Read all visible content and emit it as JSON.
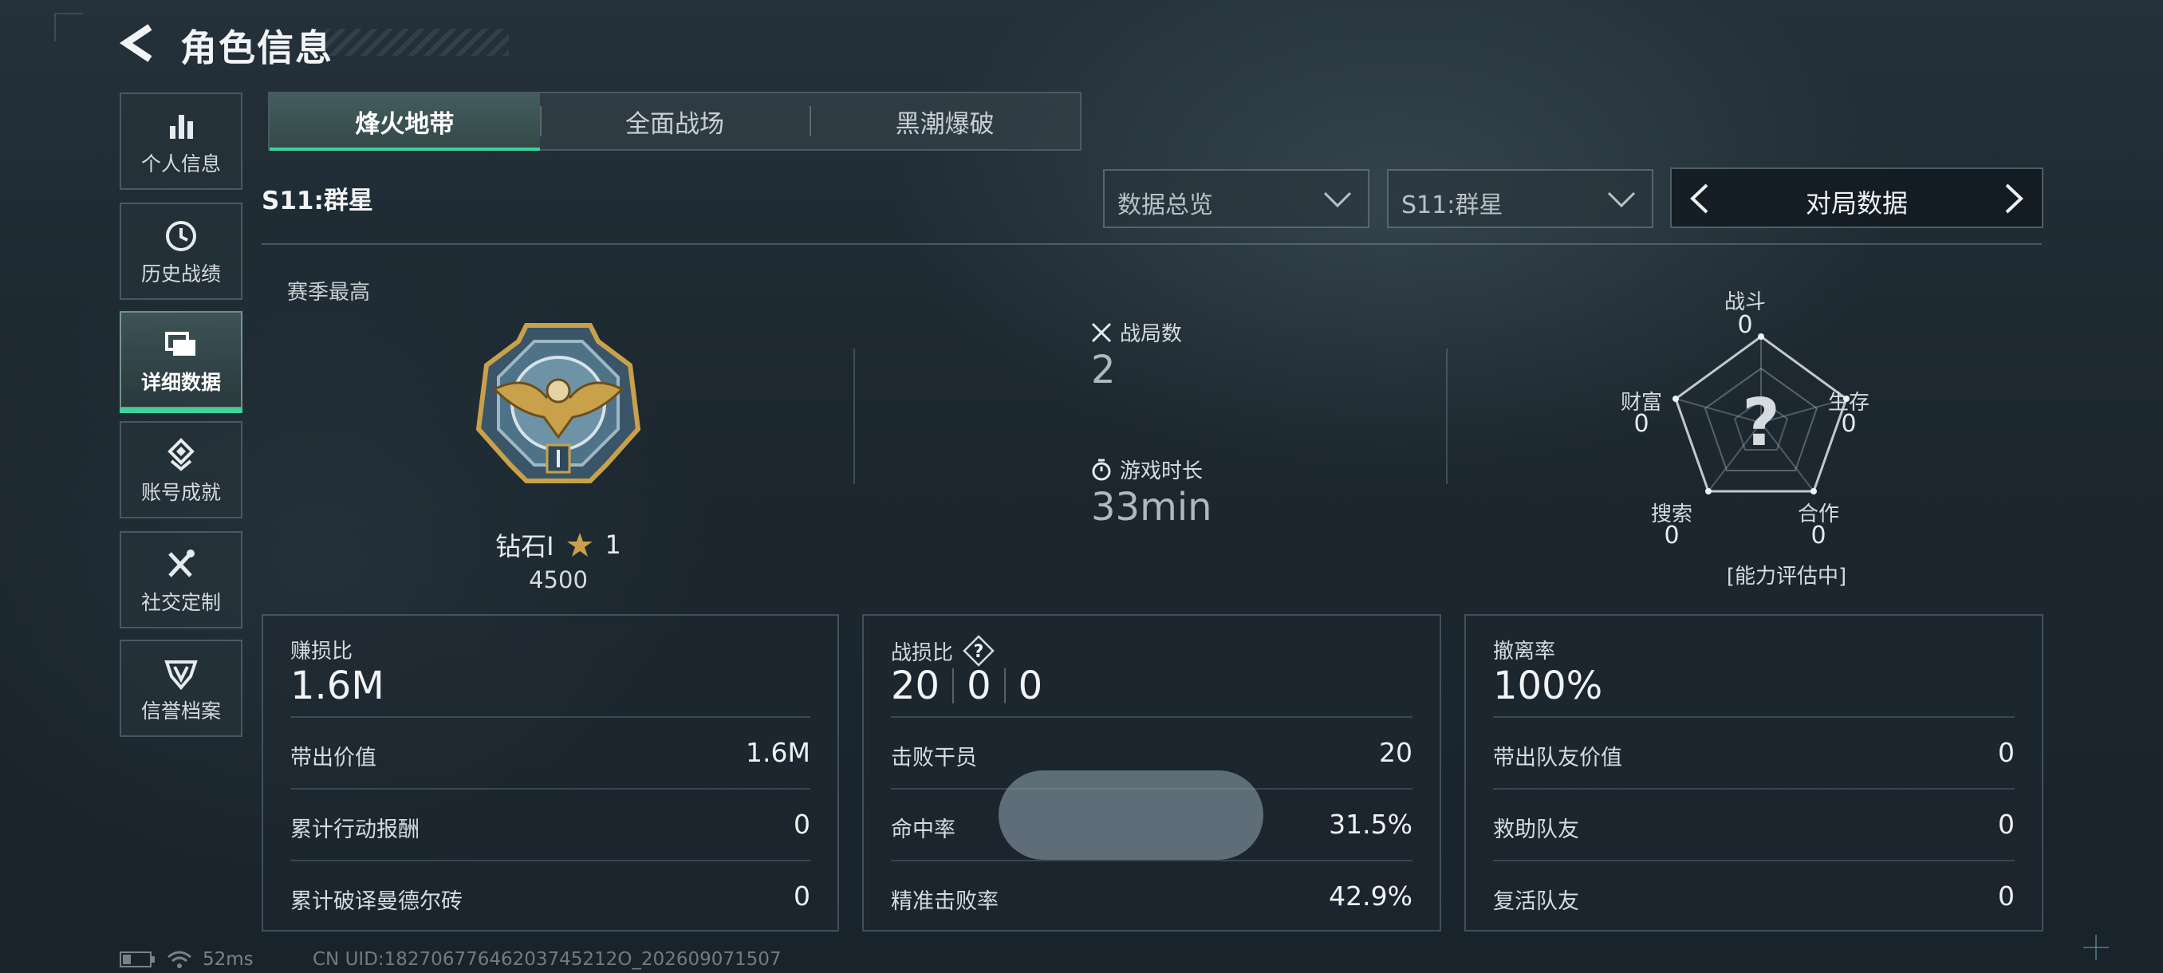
{
  "header": {
    "title": "角色信息"
  },
  "sidebar": {
    "items": [
      {
        "label": "个人信息",
        "icon": "bar-chart-icon"
      },
      {
        "label": "历史战绩",
        "icon": "clock-icon"
      },
      {
        "label": "详细数据",
        "icon": "folder-icon",
        "active": true
      },
      {
        "label": "账号成就",
        "icon": "achievement-icon"
      },
      {
        "label": "社交定制",
        "icon": "tools-icon"
      },
      {
        "label": "信誉档案",
        "icon": "shield-icon"
      }
    ]
  },
  "tabs": [
    {
      "label": "烽火地带",
      "active": true
    },
    {
      "label": "全面战场"
    },
    {
      "label": "黑潮爆破"
    }
  ],
  "season_title": "S11:群星",
  "filters": {
    "overview": "数据总览",
    "season": "S11:群星",
    "mode": "对局数据"
  },
  "peak": {
    "label": "赛季最高",
    "rank": "钻石I",
    "stars": "1",
    "score": "4500"
  },
  "summary": {
    "matches_label": "战局数",
    "matches_value": "2",
    "playtime_label": "游戏时长",
    "playtime_value": "33min"
  },
  "radar": {
    "combat_label": "战斗",
    "combat_value": "0",
    "survival_label": "生存",
    "survival_value": "0",
    "coop_label": "合作",
    "coop_value": "0",
    "search_label": "搜索",
    "search_value": "0",
    "wealth_label": "财富",
    "wealth_value": "0",
    "center": "?",
    "status": "[能力评估中]"
  },
  "cards": {
    "profit": {
      "title": "赚损比",
      "value": "1.6M",
      "rows": [
        {
          "k": "带出价值",
          "v": "1.6M"
        },
        {
          "k": "累计行动报酬",
          "v": "0"
        },
        {
          "k": "累计破译曼德尔砖",
          "v": "0"
        }
      ]
    },
    "kd": {
      "title": "战损比",
      "kills": "20",
      "deaths": "0",
      "assists": "0",
      "rows": [
        {
          "k": "击败干员",
          "v": "20"
        },
        {
          "k": "命中率",
          "v": "31.5%"
        },
        {
          "k": "精准击败率",
          "v": "42.9%"
        }
      ]
    },
    "extract": {
      "title": "撤离率",
      "value": "100%",
      "rows": [
        {
          "k": "带出队友价值",
          "v": "0"
        },
        {
          "k": "救助队友",
          "v": "0"
        },
        {
          "k": "复活队友",
          "v": "0"
        }
      ]
    }
  },
  "footer": {
    "ping": "52ms",
    "uid": "CN UID:18270677646203745212O_202609071507"
  },
  "colors": {
    "accent": "#3bd49a",
    "gold": "#c9a14a"
  }
}
